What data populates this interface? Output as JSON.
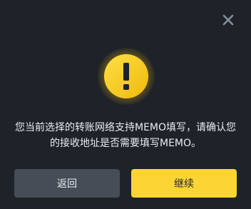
{
  "dialog": {
    "close_icon": "close-icon",
    "warning_icon": "exclamation-warning-icon",
    "message_line1": "您当前选择的转账网络支持MEMO填写，请确认您",
    "message_line2": "的接收地址是否需要填写MEMO。",
    "back_label": "返回",
    "continue_label": "继续"
  },
  "colors": {
    "background": "#1e2329",
    "accent": "#fcd535",
    "secondary_button": "#474d57",
    "text": "#eaecef",
    "close_icon": "#848e9c"
  }
}
